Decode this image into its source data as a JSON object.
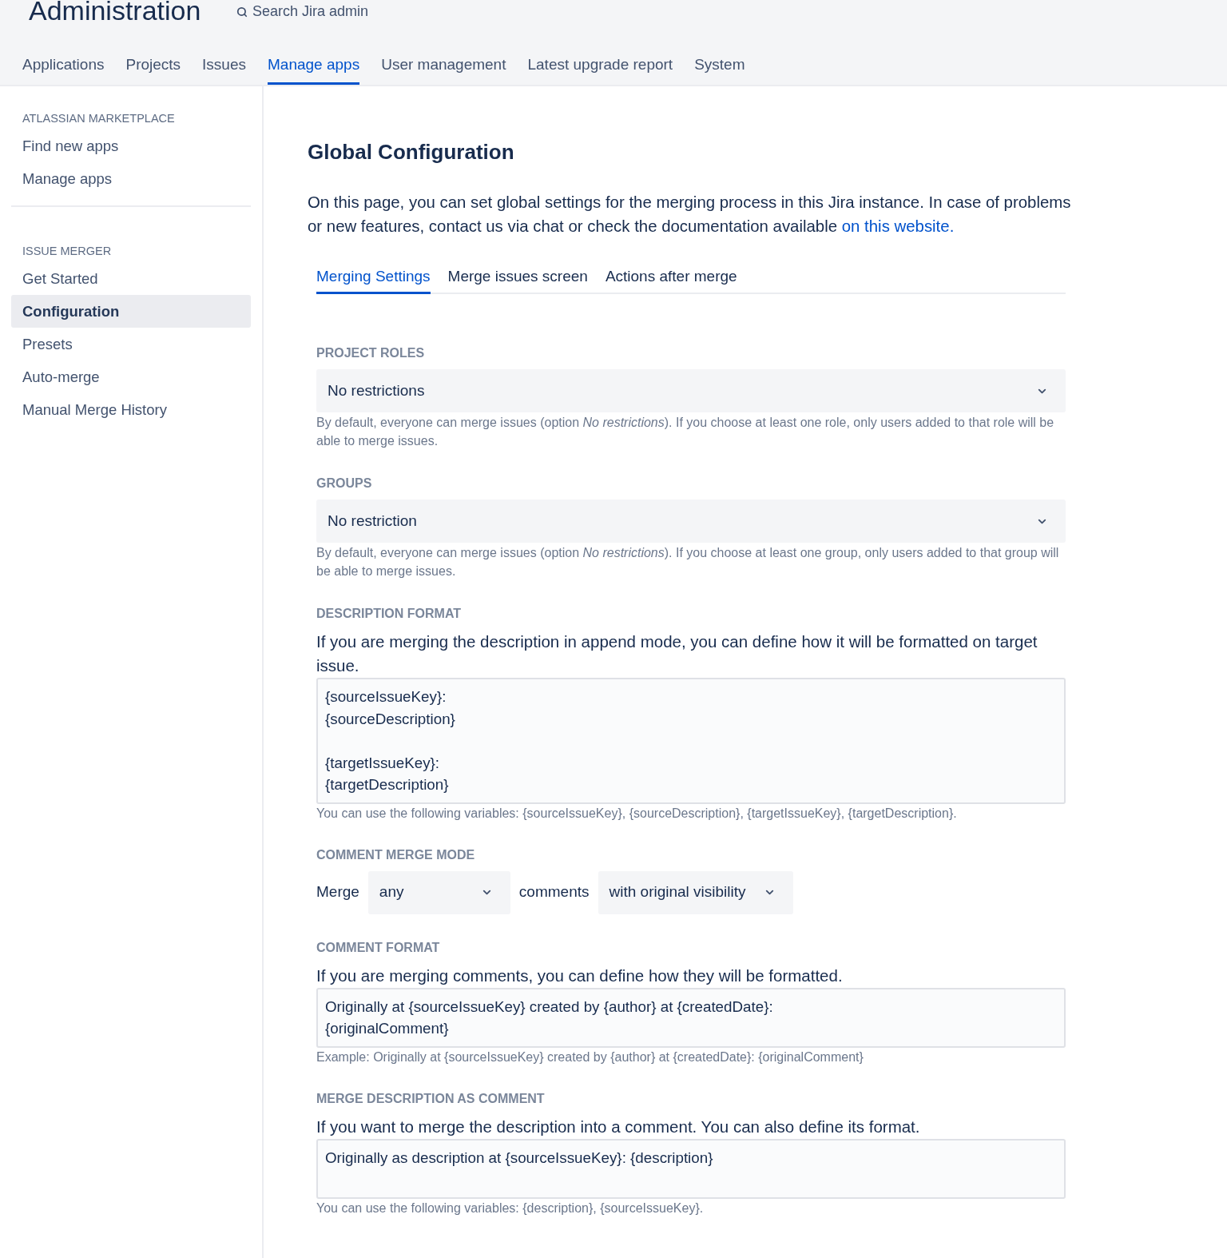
{
  "header": {
    "title": "Administration",
    "search": {
      "placeholder": "Search Jira admin"
    }
  },
  "nav_tabs": [
    {
      "label": "Applications",
      "selected": false
    },
    {
      "label": "Projects",
      "selected": false
    },
    {
      "label": "Issues",
      "selected": false
    },
    {
      "label": "Manage apps",
      "selected": true
    },
    {
      "label": "User management",
      "selected": false
    },
    {
      "label": "Latest upgrade report",
      "selected": false
    },
    {
      "label": "System",
      "selected": false
    }
  ],
  "sidebar": {
    "sections": [
      {
        "heading": "ATLASSIAN MARKETPLACE",
        "items": [
          {
            "label": "Find new apps",
            "selected": false
          },
          {
            "label": "Manage apps",
            "selected": false
          }
        ]
      },
      {
        "heading": "ISSUE MERGER",
        "items": [
          {
            "label": "Get Started",
            "selected": false
          },
          {
            "label": "Configuration",
            "selected": true
          },
          {
            "label": "Presets",
            "selected": false
          },
          {
            "label": "Auto-merge",
            "selected": false
          },
          {
            "label": "Manual Merge History",
            "selected": false
          }
        ]
      }
    ]
  },
  "main": {
    "title": "Global Configuration",
    "intro": "On this page, you can set global settings for the merging process in this Jira instance. In case of problems or new features, contact us via chat or check the documentation available",
    "intro_link": "on this website.",
    "tabs": [
      {
        "label": "Merging Settings",
        "selected": true
      },
      {
        "label": "Merge issues screen",
        "selected": false
      },
      {
        "label": "Actions after merge",
        "selected": false
      }
    ],
    "sections": [
      {
        "kind": "select",
        "label": "PROJECT ROLES",
        "value": "No restrictions",
        "help": "By default, everyone can merge issues (option *No restrictions*). If you choose at least one role, only users added to that role will be able to merge issues."
      },
      {
        "kind": "select",
        "label": "GROUPS",
        "value": "No restriction",
        "help": "By default, everyone can merge issues (option *No restrictions*). If you choose at least one group, only users added to that group will be able to merge issues."
      },
      {
        "kind": "textarea",
        "label": "DESCRIPTION FORMAT",
        "description": "If you are merging the description in append mode, you can define how it will be formatted on target issue.",
        "value": "{sourceIssueKey}:\n{sourceDescription}\n\n{targetIssueKey}:\n{targetDescription}",
        "help": "You can use the following variables: {sourceIssueKey}, {sourceDescription}, {targetIssueKey}, {targetDescription}."
      },
      {
        "kind": "inline",
        "label": "COMMENT MERGE MODE",
        "parts": [
          {
            "kind": "text",
            "text": "Merge"
          },
          {
            "kind": "select",
            "value": "any"
          },
          {
            "kind": "text",
            "text": "comments"
          },
          {
            "kind": "select",
            "value": "with original visibility"
          }
        ]
      },
      {
        "kind": "textarea",
        "label": "COMMENT FORMAT",
        "description": "If you are merging comments, you can define how they will be formatted.",
        "value": "Originally at {sourceIssueKey} created by {author} at {createdDate}:\n{originalComment}",
        "help": "Example: Originally at {sourceIssueKey} created by {author} at {createdDate}: {originalComment}"
      },
      {
        "kind": "textarea",
        "label": "MERGE DESCRIPTION AS COMMENT",
        "description": "If you want to merge the description into a comment. You can also define its format.",
        "value": "Originally as description at {sourceIssueKey}: {description}",
        "help": "You can use the following variables: {description}, {sourceIssueKey}."
      }
    ]
  }
}
